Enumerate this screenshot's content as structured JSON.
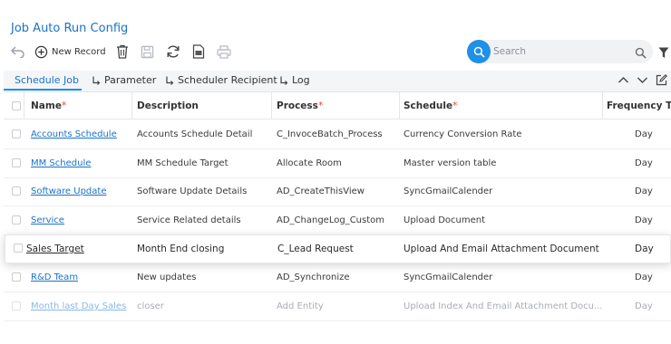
{
  "page": {
    "title": "Job Auto Run Config"
  },
  "toolbar": {
    "new_record_label": "New Record",
    "icons": [
      "undo-icon",
      "plus-circle-icon",
      "trash-icon",
      "save-icon",
      "refresh-icon",
      "export-icon",
      "print-icon"
    ]
  },
  "search": {
    "placeholder": "Search"
  },
  "tabs": [
    {
      "label": "Schedule Job",
      "active": true
    },
    {
      "label": "Parameter",
      "active": false
    },
    {
      "label": "Scheduler Recipient",
      "active": false
    },
    {
      "label": "Log",
      "active": false
    }
  ],
  "table": {
    "columns": [
      {
        "label": "Name",
        "required": true
      },
      {
        "label": "Description",
        "required": false
      },
      {
        "label": "Process",
        "required": true
      },
      {
        "label": "Schedule",
        "required": true
      },
      {
        "label": "Frequency T",
        "required": false
      }
    ],
    "required_mark": "*",
    "rows": [
      {
        "name": "Accounts Schedule",
        "description": "Accounts Schedule Detail",
        "process": "C_InvoceBatch_Process",
        "schedule": "Currency Conversion Rate",
        "frequency": "Day"
      },
      {
        "name": "MM Schedule",
        "description": "MM Schedule Target",
        "process": "Allocate Room",
        "schedule": "Master version table",
        "frequency": "Day"
      },
      {
        "name": "Software Update",
        "description": "Software Update Details",
        "process": "AD_CreateThisView",
        "schedule": "SyncGmailCalender",
        "frequency": "Day"
      },
      {
        "name": "Service",
        "description": "Service Related details",
        "process": "AD_ChangeLog_Custom",
        "schedule": "Upload Document",
        "frequency": "Day"
      },
      {
        "name": "Sales Target",
        "description": "Month End closing",
        "process": "C_Lead Request",
        "schedule": "Upload And Email Attachment Document",
        "frequency": "Day"
      },
      {
        "name": "R&D Team",
        "description": "New updates",
        "process": "AD_Synchronize",
        "schedule": "SyncGmailCalender",
        "frequency": "Day"
      },
      {
        "name": "Month last Day Sales",
        "description": "closer",
        "process": "Add Entity",
        "schedule": "Upload Index And Email Attachment Docu...",
        "frequency": "Day"
      }
    ]
  },
  "colors": {
    "accent": "#1e90e8",
    "link": "#1a73c8",
    "required": "#e0452f"
  }
}
